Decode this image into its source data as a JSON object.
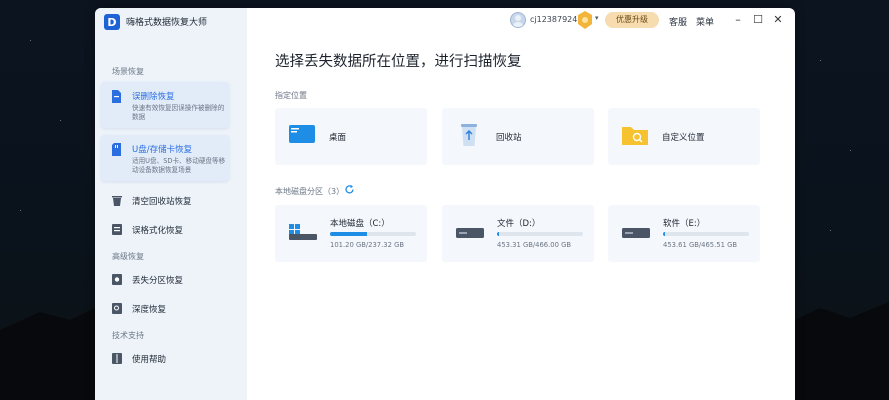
{
  "app": {
    "title": "嗨格式数据恢复大师",
    "logo_letter": "D"
  },
  "topbar": {
    "username": "cj12387924",
    "upgrade_label": "优惠升级",
    "service_label": "客服",
    "menu_label": "菜单",
    "window_controls": [
      "minimize-icon",
      "maximize-icon",
      "close-icon"
    ]
  },
  "sidebar": {
    "section_scene": "场景恢复",
    "cards": [
      {
        "title": "误删除恢复",
        "desc": "快速有效恢复因误操作被删除的数据",
        "icon": "file-delete-icon"
      },
      {
        "title": "U盘/存储卡恢复",
        "desc": "适用U盘、SD卡、移动硬盘等移动设备数据恢复场景",
        "icon": "sd-card-icon"
      }
    ],
    "items_basic": [
      {
        "label": "清空回收站恢复",
        "icon": "recycle-bin-icon"
      },
      {
        "label": "误格式化恢复",
        "icon": "format-icon"
      }
    ],
    "section_advanced": "高级恢复",
    "items_advanced": [
      {
        "label": "丢失分区恢复",
        "icon": "partition-icon"
      },
      {
        "label": "深度恢复",
        "icon": "deep-scan-icon"
      }
    ],
    "section_support": "技术支持",
    "items_support": [
      {
        "label": "使用帮助",
        "icon": "help-book-icon"
      }
    ]
  },
  "main": {
    "title": "选择丢失数据所在位置，进行扫描恢复",
    "locations_label": "指定位置",
    "locations": [
      {
        "label": "桌面",
        "icon": "desktop-icon"
      },
      {
        "label": "回收站",
        "icon": "recycle-bin-icon"
      },
      {
        "label": "自定义位置",
        "icon": "folder-icon"
      }
    ],
    "disks_label": "本地磁盘分区（3）",
    "disks": [
      {
        "name": "本地磁盘（C:）",
        "size": "101.20 GB/237.32 GB",
        "used_fraction": 0.426,
        "icon": "system-drive-icon"
      },
      {
        "name": "文件（D:）",
        "size": "453.31 GB/466.00 GB",
        "used_fraction": 0.027,
        "icon": "hard-drive-icon"
      },
      {
        "name": "软件（E:）",
        "size": "453.61 GB/465.51 GB",
        "used_fraction": 0.026,
        "icon": "hard-drive-icon"
      }
    ]
  },
  "colors": {
    "accent": "#1e8de6",
    "active_text": "#2a6ee0",
    "upgrade_bg": "#f6dcae"
  }
}
